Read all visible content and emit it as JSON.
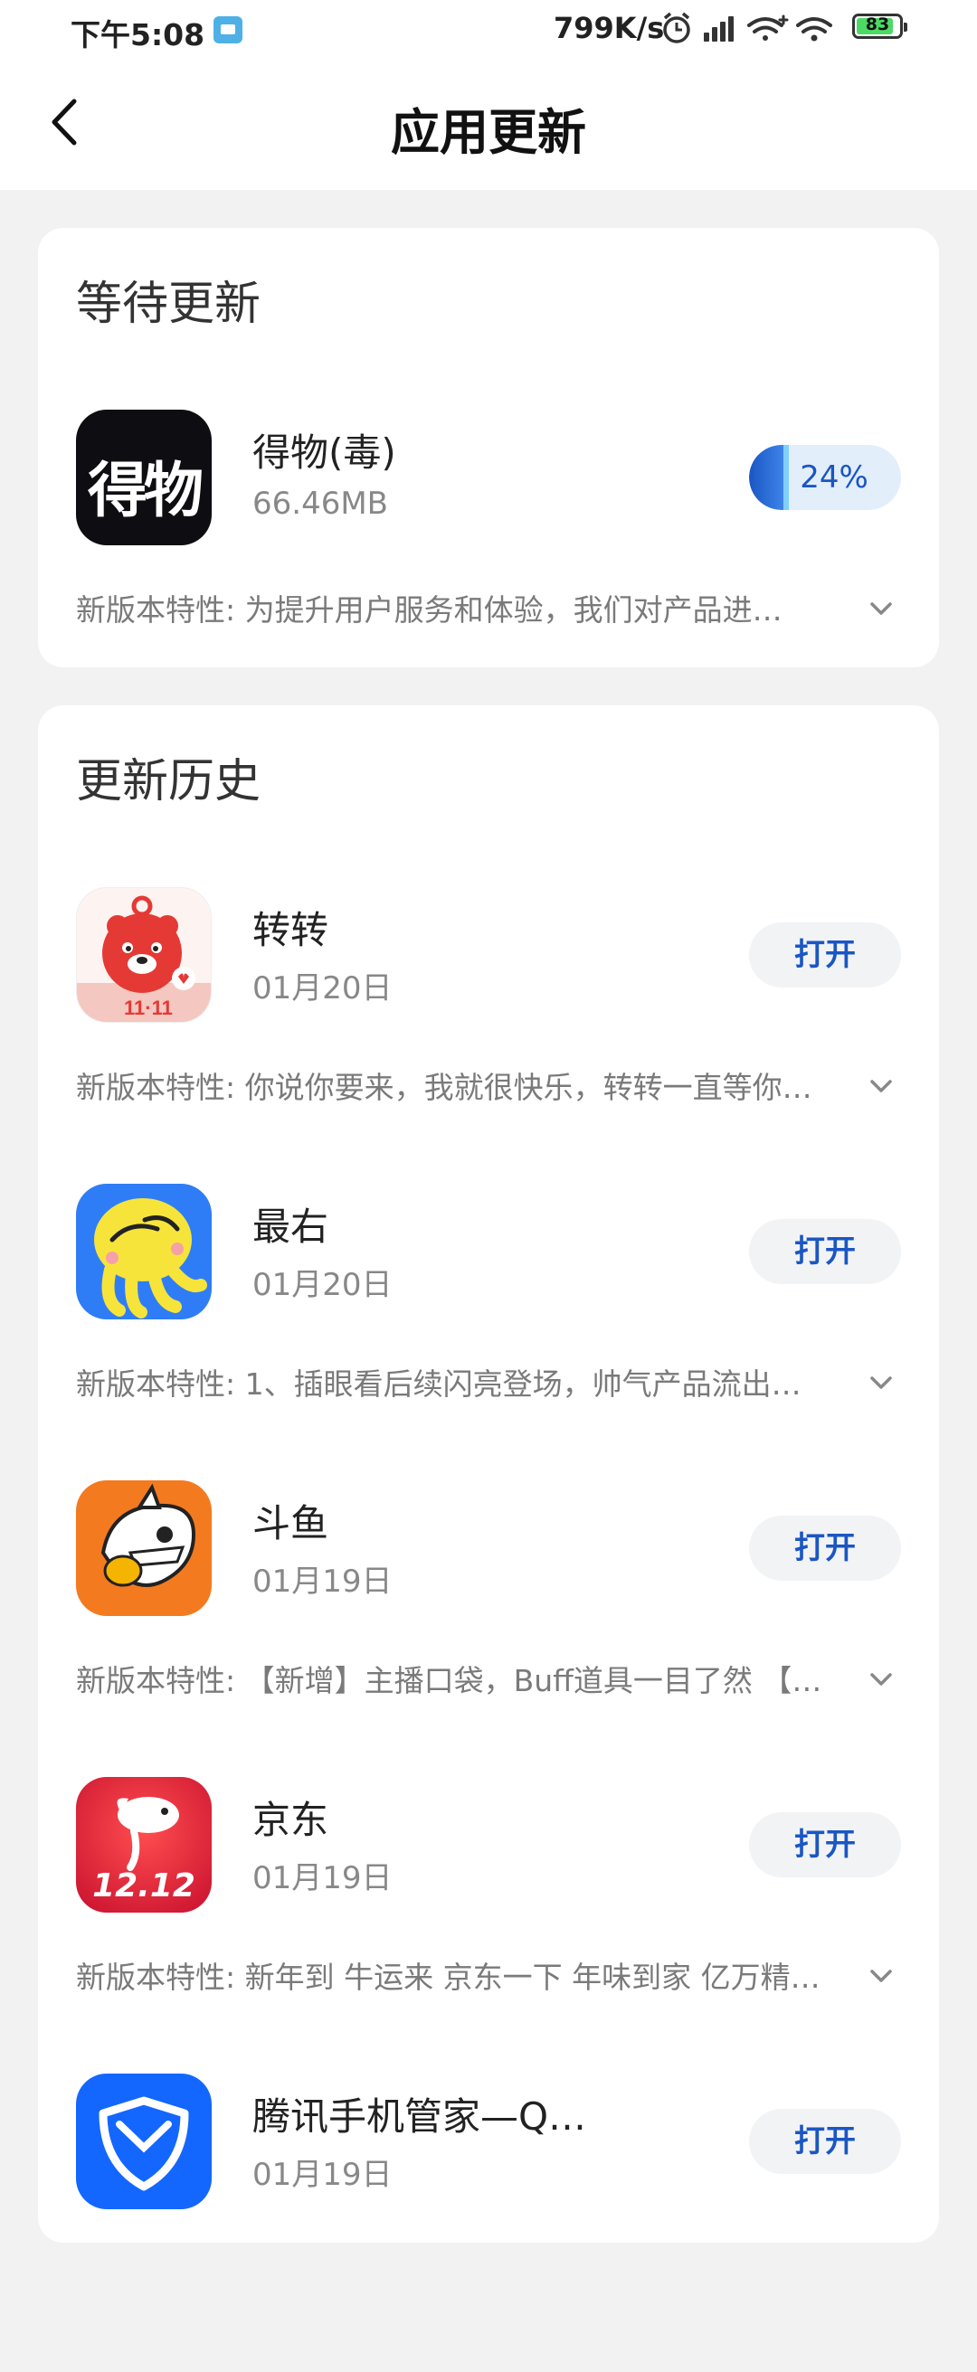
{
  "status_bar": {
    "time": "下午5:08",
    "net_speed": "799K/s",
    "battery": "83"
  },
  "header": {
    "title": "应用更新"
  },
  "waiting": {
    "section_title": "等待更新",
    "apps": [
      {
        "name": "得物(毒)",
        "size": "66.46MB",
        "progress_text": "24%",
        "progress": 0.24,
        "icon_text": "得物",
        "notes": "新版本特性: 为提升用户服务和体验，我们对产品进…"
      }
    ]
  },
  "history": {
    "section_title": "更新历史",
    "apps": [
      {
        "name": "转转",
        "date": "01月20日",
        "button": "打开",
        "notes": "新版本特性: 你说你要来，我就很快乐，转转一直等你…"
      },
      {
        "name": "最右",
        "date": "01月20日",
        "button": "打开",
        "notes": "新版本特性: 1、插眼看后续闪亮登场，帅气产品流出…"
      },
      {
        "name": "斗鱼",
        "date": "01月19日",
        "button": "打开",
        "notes": "新版本特性: 【新增】主播口袋，Buff道具一目了然 【…"
      },
      {
        "name": "京东",
        "date": "01月19日",
        "button": "打开",
        "icon_text": "12.12",
        "notes": "新版本特性: 新年到 牛运来 京东一下 年味到家 亿万精…"
      },
      {
        "name": "腾讯手机管家—Q…",
        "date": "01月19日",
        "button": "打开"
      }
    ]
  },
  "colors": {
    "accent": "#1a56c4",
    "page_bg": "#f2f2f2",
    "card_bg": "#ffffff"
  }
}
